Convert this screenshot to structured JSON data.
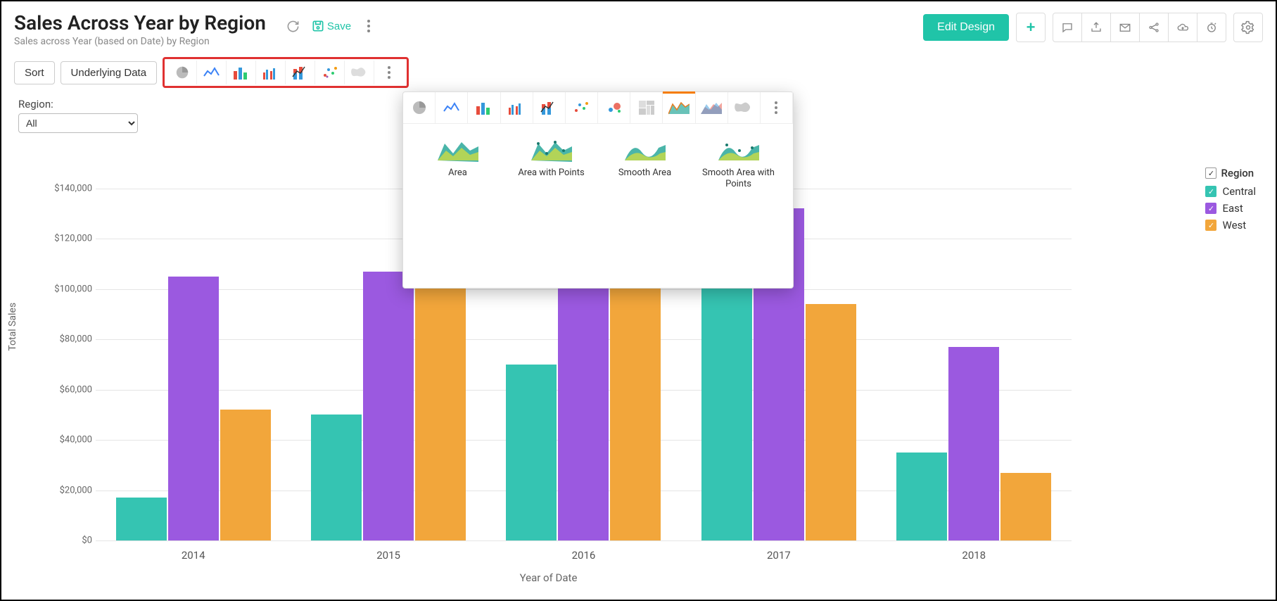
{
  "header": {
    "title": "Sales Across Year by Region",
    "subtitle": "Sales across Year (based on Date) by Region",
    "save_label": "Save",
    "edit_design_label": "Edit Design"
  },
  "toolbar": {
    "sort_label": "Sort",
    "underlying_label": "Underlying Data"
  },
  "filter": {
    "label": "Region:",
    "value": "All"
  },
  "legend": {
    "header": "Region",
    "items": [
      {
        "name": "Central",
        "color": "#35c4b2"
      },
      {
        "name": "East",
        "color": "#9b59e0"
      },
      {
        "name": "West",
        "color": "#f2a63b"
      }
    ]
  },
  "popover": {
    "options": [
      {
        "label": "Area"
      },
      {
        "label": "Area with Points"
      },
      {
        "label": "Smooth Area"
      },
      {
        "label": "Smooth Area with Points"
      }
    ]
  },
  "chart_data": {
    "type": "bar",
    "title": "Sales Across Year by Region",
    "xlabel": "Year of Date",
    "ylabel": "Total Sales",
    "categories": [
      "2014",
      "2015",
      "2016",
      "2017",
      "2018"
    ],
    "series": [
      {
        "name": "Central",
        "color": "#35c4b2",
        "values": [
          17000,
          50000,
          70000,
          139000,
          35000
        ]
      },
      {
        "name": "East",
        "color": "#9b59e0",
        "values": [
          105000,
          107000,
          107000,
          132000,
          77000
        ]
      },
      {
        "name": "West",
        "color": "#f2a63b",
        "values": [
          52000,
          103000,
          104000,
          94000,
          27000
        ]
      }
    ],
    "ylim": [
      0,
      150000
    ],
    "y_ticks": [
      0,
      20000,
      40000,
      60000,
      80000,
      100000,
      120000,
      140000
    ],
    "y_tick_labels": [
      "$0",
      "$20,000",
      "$40,000",
      "$60,000",
      "$80,000",
      "$100,000",
      "$120,000",
      "$140,000"
    ]
  }
}
